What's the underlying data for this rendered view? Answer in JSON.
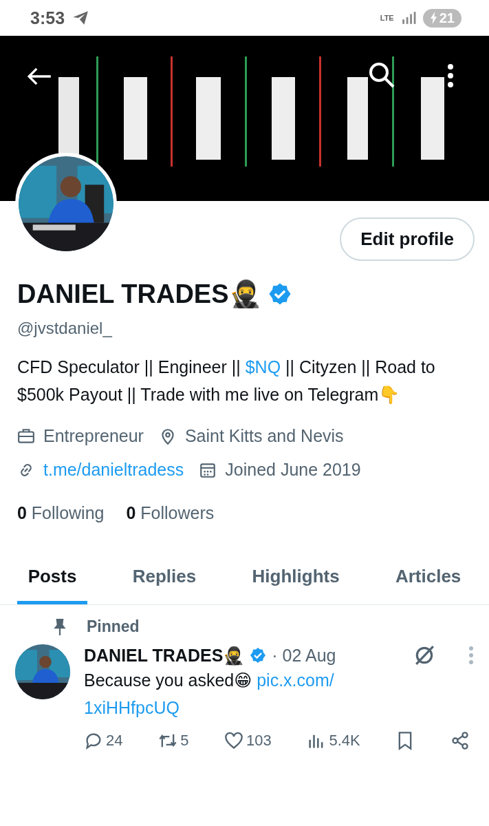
{
  "status_bar": {
    "time": "3:53",
    "network": "LTE",
    "battery": "21"
  },
  "profile": {
    "name": "DANIEL TRADES🥷",
    "verified": true,
    "handle": "@jvstdaniel_",
    "edit_button": "Edit profile",
    "bio": [
      {
        "text": "CFD Speculator || Engineer || ",
        "kind": "plain"
      },
      {
        "text": "$NQ",
        "kind": "link"
      },
      {
        "text": " || Cityzen || Road to $500k Payout || Trade with me live on Telegram👇",
        "kind": "plain"
      }
    ],
    "meta": [
      {
        "kind": "work",
        "text": "Entrepreneur",
        "link": false
      },
      {
        "kind": "location",
        "text": "Saint Kitts and Nevis",
        "link": false
      },
      {
        "kind": "url",
        "text": "t.me/danieltradess",
        "link": true
      },
      {
        "kind": "joined",
        "text": "Joined June 2019",
        "link": false
      }
    ],
    "following": {
      "count": "0",
      "label": "Following"
    },
    "followers": {
      "count": "0",
      "label": "Followers"
    }
  },
  "tabs": [
    {
      "label": "Posts",
      "selected": true
    },
    {
      "label": "Replies",
      "selected": false
    },
    {
      "label": "Highlights",
      "selected": false
    },
    {
      "label": "Articles",
      "selected": false
    }
  ],
  "post": {
    "pinned": "Pinned",
    "author": "DANIEL TRADES🥷",
    "verified": true,
    "date": "· 02 Aug",
    "text": "Because you asked😁 ",
    "link": [
      "pic.x.com/",
      "1xiHHfpcUQ"
    ],
    "stats": [
      {
        "kind": "reply",
        "count": "24"
      },
      {
        "kind": "repost",
        "count": "5"
      },
      {
        "kind": "like",
        "count": "103"
      },
      {
        "kind": "views",
        "count": "5.4K"
      },
      {
        "kind": "bookmark"
      },
      {
        "kind": "share"
      }
    ]
  }
}
